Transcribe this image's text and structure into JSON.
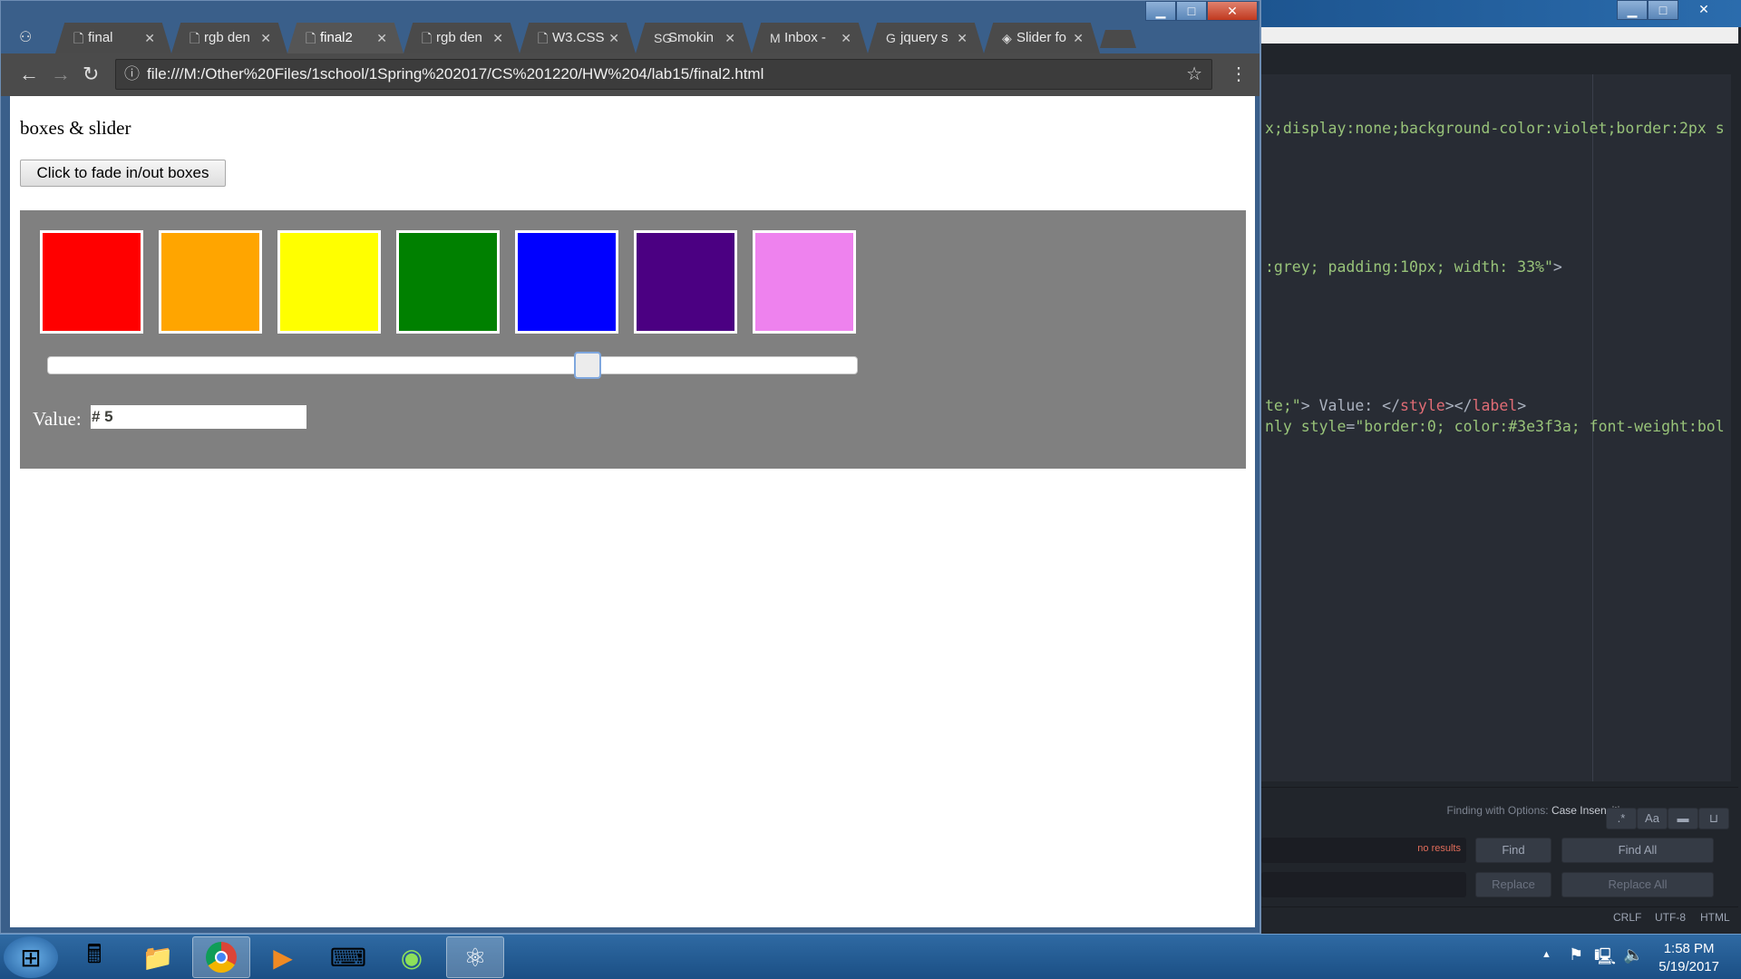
{
  "browser": {
    "tabs": [
      {
        "label": "final",
        "icon": "page-icon",
        "active": false
      },
      {
        "label": "rgb den",
        "icon": "page-icon",
        "active": false
      },
      {
        "label": "final2",
        "icon": "page-icon",
        "active": true
      },
      {
        "label": "rgb den",
        "icon": "page-icon",
        "active": false
      },
      {
        "label": "W3.CSS",
        "icon": "page-icon",
        "active": false
      },
      {
        "label": "Smokin",
        "icon": "sg-icon",
        "active": false
      },
      {
        "label": "Inbox -",
        "icon": "gmail-icon",
        "active": false
      },
      {
        "label": "jquery s",
        "icon": "google-icon",
        "active": false
      },
      {
        "label": "Slider fo",
        "icon": "slider-site-icon",
        "active": false
      }
    ],
    "url": "file:///M:/Other%20Files/1school/1Spring%202017/CS%201220/HW%204/lab15/final2.html"
  },
  "page": {
    "heading": "boxes & slider",
    "fade_button": "Click to fade in/out boxes",
    "boxes": [
      "#ff0000",
      "#ffa500",
      "#ffff00",
      "#008000",
      "#0000ff",
      "#4b0082",
      "#ee82ee"
    ],
    "panel_color": "#808080",
    "slider": {
      "min": 1,
      "max": 7,
      "value": 5
    },
    "value_label": "Value:",
    "value_text": "# 5"
  },
  "editor": {
    "code_lines": [
      {
        "parts": [
          [
            "x;display:none;background-color:violet;border:2px s",
            "g"
          ]
        ]
      },
      {
        "parts": [
          [
            ":grey; padding:10px; width: 33%\"",
            "g"
          ],
          [
            ">",
            "w"
          ]
        ]
      },
      {
        "parts": [
          [
            "te;\"",
            "g"
          ],
          [
            "> Value: </",
            "w"
          ],
          [
            "style",
            "r"
          ],
          [
            "></",
            "w"
          ],
          [
            "label",
            "r"
          ],
          [
            ">",
            "w"
          ]
        ]
      },
      {
        "parts": [
          [
            "nly ",
            "g"
          ],
          [
            "style",
            "g"
          ],
          [
            "=",
            "w"
          ],
          [
            "\"border:0; color:#3e3f3a; font-weight:bol",
            "g"
          ]
        ]
      }
    ],
    "find": {
      "options_label": "Finding with Options:",
      "options_value": "Case Insensitive",
      "option_buttons": [
        ".*",
        "Aa",
        "▬",
        "⊔"
      ],
      "no_results": "no results",
      "find": "Find",
      "find_all": "Find All",
      "replace": "Replace",
      "replace_all": "Replace All"
    },
    "status": [
      "CRLF",
      "UTF-8",
      "HTML"
    ]
  },
  "taskbar": {
    "time": "1:58 PM",
    "date": "5/19/2017"
  }
}
